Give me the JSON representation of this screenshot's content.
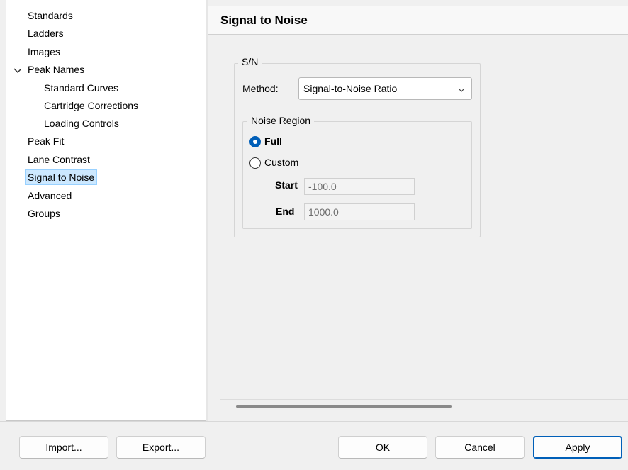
{
  "tree": {
    "items": [
      {
        "label": "Standards"
      },
      {
        "label": "Ladders"
      },
      {
        "label": "Images"
      },
      {
        "label": "Peak Names",
        "expanded": true
      },
      {
        "label": "Standard Curves"
      },
      {
        "label": "Cartridge Corrections"
      },
      {
        "label": "Loading Controls"
      },
      {
        "label": "Peak Fit"
      },
      {
        "label": "Lane Contrast"
      },
      {
        "label": "Signal to Noise",
        "selected": true
      },
      {
        "label": "Advanced"
      },
      {
        "label": "Groups"
      }
    ]
  },
  "panel": {
    "title": "Signal to Noise",
    "sn_group": {
      "title": "S/N",
      "method_label": "Method:",
      "method_value": "Signal-to-Noise Ratio"
    },
    "noise_region": {
      "title": "Noise Region",
      "options": [
        {
          "label": "Full",
          "checked": true
        },
        {
          "label": "Custom",
          "checked": false
        }
      ],
      "start_label": "Start",
      "start_value": "-100.0",
      "end_label": "End",
      "end_value": "1000.0"
    }
  },
  "footer": {
    "import_label": "Import...",
    "export_label": "Export...",
    "ok_label": "OK",
    "cancel_label": "Cancel",
    "apply_label": "Apply"
  },
  "colors": {
    "accent": "#005fb8",
    "selection_bg": "#cce8ff",
    "selection_border": "#99d1ff"
  },
  "icons": {
    "expand": "chevron-down-icon",
    "combo": "chevron-down-icon"
  }
}
